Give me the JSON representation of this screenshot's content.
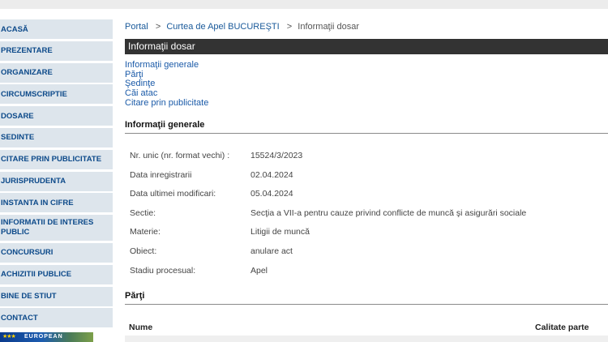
{
  "sidebar": {
    "items": [
      {
        "label": "ACASĂ"
      },
      {
        "label": "PREZENTARE"
      },
      {
        "label": "ORGANIZARE"
      },
      {
        "label": "CIRCUMSCRIPTIE"
      },
      {
        "label": "DOSARE"
      },
      {
        "label": "SEDINTE"
      },
      {
        "label": "CITARE PRIN PUBLICITATE"
      },
      {
        "label": "JURISPRUDENTA"
      },
      {
        "label": "INSTANTA IN CIFRE"
      },
      {
        "label": "INFORMATII DE INTERES PUBLIC"
      },
      {
        "label": "CONCURSURI"
      },
      {
        "label": "ACHIZITII PUBLICE"
      },
      {
        "label": "BINE DE STIUT"
      },
      {
        "label": "CONTACT"
      }
    ],
    "banner_text": "EUROPEAN"
  },
  "breadcrumb": {
    "items": [
      "Portal",
      "Curtea de Apel BUCUREŞTI",
      "Informaţii dosar"
    ],
    "separator": ">"
  },
  "page": {
    "title": "Informaţii dosar"
  },
  "toc": {
    "links": [
      "Informaţii generale",
      "Părţi",
      "Şedinţe",
      "Căi atac",
      "Citare prin publicitate"
    ]
  },
  "general": {
    "heading": "Informaţii generale",
    "rows": [
      {
        "label": "Nr. unic (nr. format vechi) :",
        "value": "15524/3/2023"
      },
      {
        "label": "Data inregistrarii",
        "value": "02.04.2024"
      },
      {
        "label": "Data ultimei modificari:",
        "value": "05.04.2024"
      },
      {
        "label": "Sectie:",
        "value": "Secţia a VII-a pentru cauze privind conflicte de muncă şi asigurări sociale"
      },
      {
        "label": "Materie:",
        "value": "Litigii de muncă"
      },
      {
        "label": "Obiect:",
        "value": "anulare act"
      },
      {
        "label": "Stadiu procesual:",
        "value": "Apel"
      }
    ]
  },
  "parti": {
    "heading": "Părţi",
    "columns": [
      "Nume",
      "Calitate parte"
    ]
  }
}
